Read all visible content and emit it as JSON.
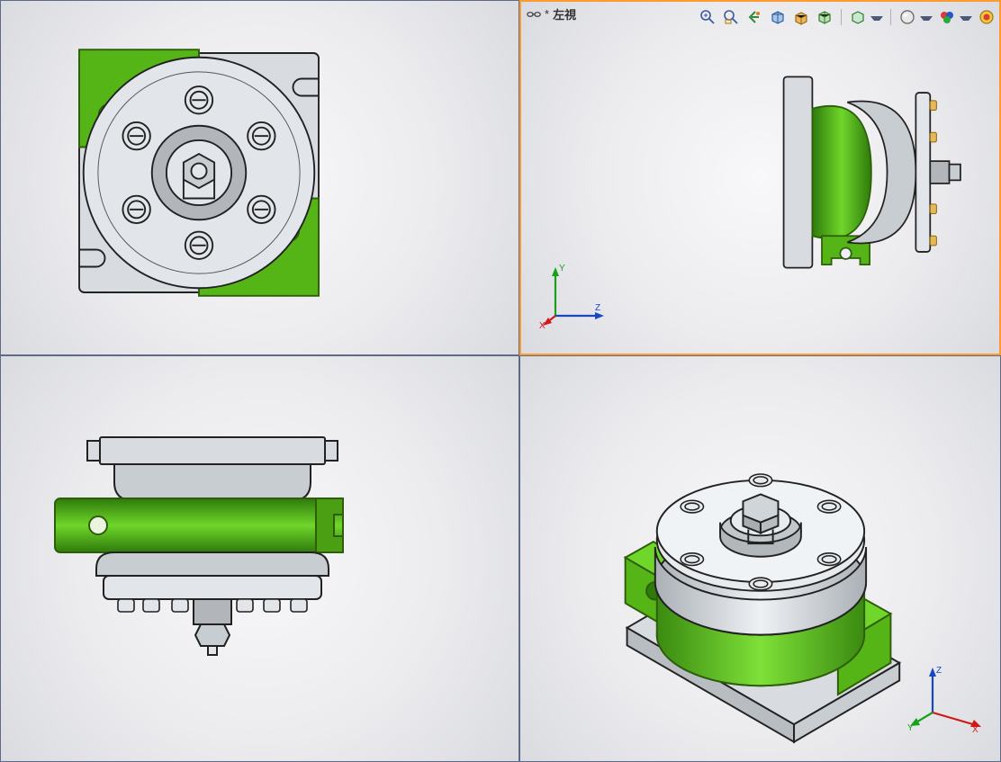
{
  "viewports": {
    "top_right": {
      "label_prefix": "*",
      "label_text": "左視"
    }
  },
  "triads": {
    "tr": {
      "x_label": "X",
      "y_label": "Y",
      "z_label": "Z"
    },
    "br": {
      "x_label": "X",
      "y_label": "Y",
      "z_label": "Z"
    }
  },
  "toolbar": {
    "items": [
      {
        "name": "zoom-to-fit-icon"
      },
      {
        "name": "zoom-area-icon"
      },
      {
        "name": "previous-view-icon"
      },
      {
        "name": "section-view-icon"
      },
      {
        "name": "view-orientation-icon"
      },
      {
        "name": "display-style-icon"
      },
      {
        "sep": true
      },
      {
        "name": "hide-show-icon",
        "dropdown": true
      },
      {
        "sep": true
      },
      {
        "name": "scene-icon",
        "dropdown": true
      },
      {
        "name": "appearances-icon",
        "dropdown": true
      },
      {
        "name": "decals-icon"
      }
    ]
  }
}
